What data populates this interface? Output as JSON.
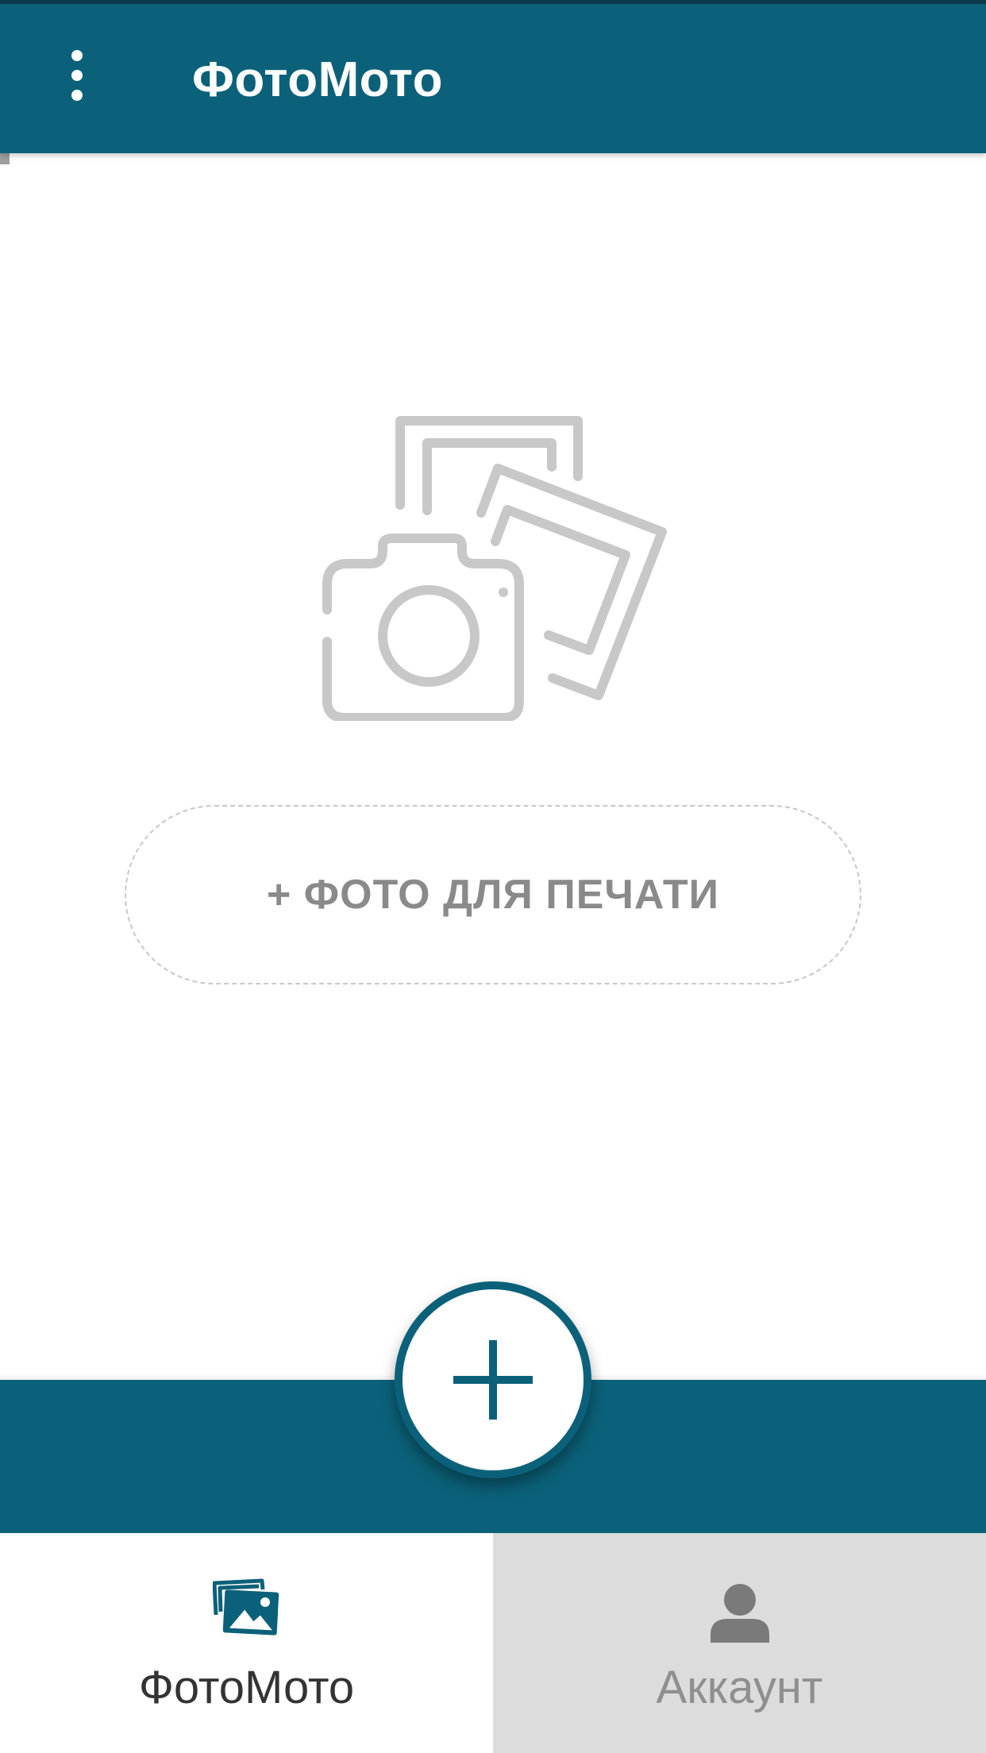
{
  "colors": {
    "primary": "#0b6179",
    "illustration": "#c8c8c8",
    "inactive_tab_bg": "#dcdcdc"
  },
  "app_bar": {
    "title": "ФотоМото",
    "menu_icon": "more-vert-icon"
  },
  "empty_state": {
    "illustration_icon": "camera-photos-icon",
    "add_photo_label": "+ ФОТО ДЛЯ ПЕЧАТИ"
  },
  "fab": {
    "icon": "plus-icon"
  },
  "bottom_nav": {
    "items": [
      {
        "label": "ФотоМото",
        "icon": "photos-icon",
        "active": true
      },
      {
        "label": "Аккаунт",
        "icon": "person-icon",
        "active": false
      }
    ]
  }
}
